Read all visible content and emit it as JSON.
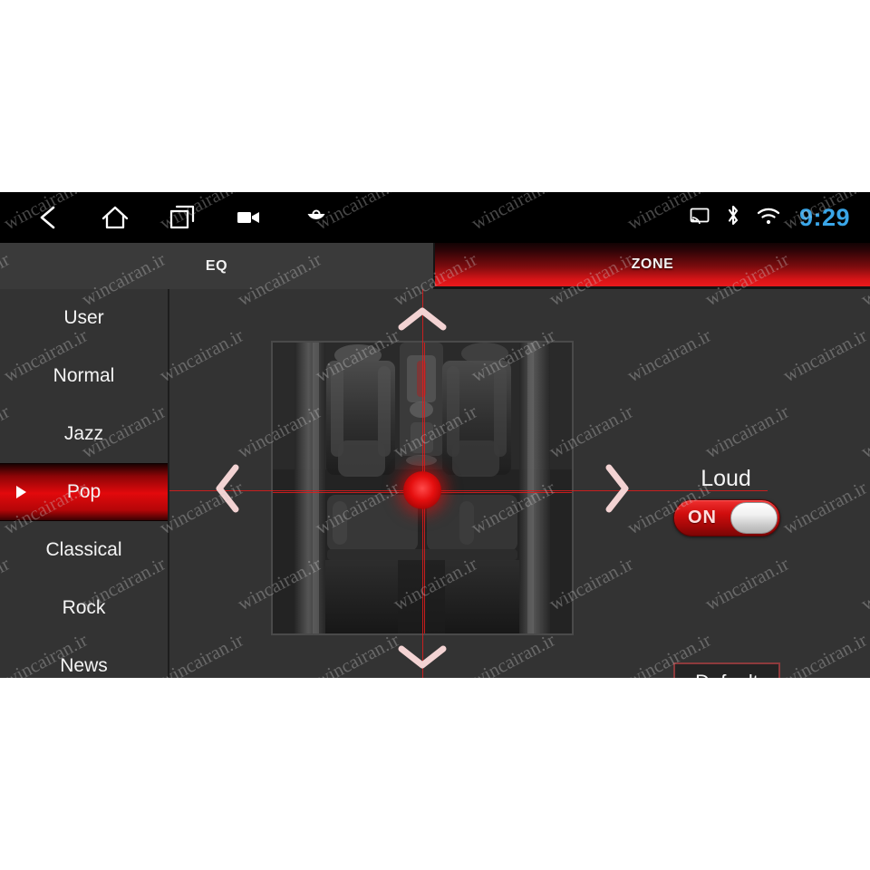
{
  "statusbar": {
    "nav_items": [
      {
        "name": "back-icon",
        "label": "Back"
      },
      {
        "name": "home-icon",
        "label": "Home"
      },
      {
        "name": "recents-icon",
        "label": "Recent apps"
      },
      {
        "name": "video-camera-icon",
        "label": "Screen record"
      },
      {
        "name": "bag-icon",
        "label": "Apps"
      }
    ],
    "indicators": [
      {
        "name": "cast-icon",
        "label": "Cast"
      },
      {
        "name": "bluetooth-icon",
        "label": "Bluetooth"
      },
      {
        "name": "wifi-icon",
        "label": "Wi-Fi"
      }
    ],
    "clock": "9:29",
    "clock_color": "#3aa6e8"
  },
  "tabs": [
    {
      "label": "EQ",
      "active": false
    },
    {
      "label": "ZONE",
      "active": true
    }
  ],
  "presets": [
    {
      "label": "User",
      "selected": false
    },
    {
      "label": "Normal",
      "selected": false
    },
    {
      "label": "Jazz",
      "selected": false
    },
    {
      "label": "Pop",
      "selected": true
    },
    {
      "label": "Classical",
      "selected": false
    },
    {
      "label": "Rock",
      "selected": false
    },
    {
      "label": "News",
      "selected": false
    }
  ],
  "zone": {
    "up_label": "Move zone up",
    "down_label": "Move zone down",
    "left_label": "Move zone left",
    "right_label": "Move zone right",
    "image_label": "Car interior top view",
    "position_dot_label": "Sound focus point"
  },
  "controls": {
    "loud_label": "Loud",
    "loud_state": "ON",
    "default_label": "Default"
  },
  "colors": {
    "accent_red": "#e2090c",
    "tab_active_red": "#e8191c",
    "clock_blue": "#3aa6e8",
    "panel_bg": "#333333",
    "statusbar_bg": "#000000"
  },
  "watermark": {
    "text": "wincairan.ir"
  }
}
